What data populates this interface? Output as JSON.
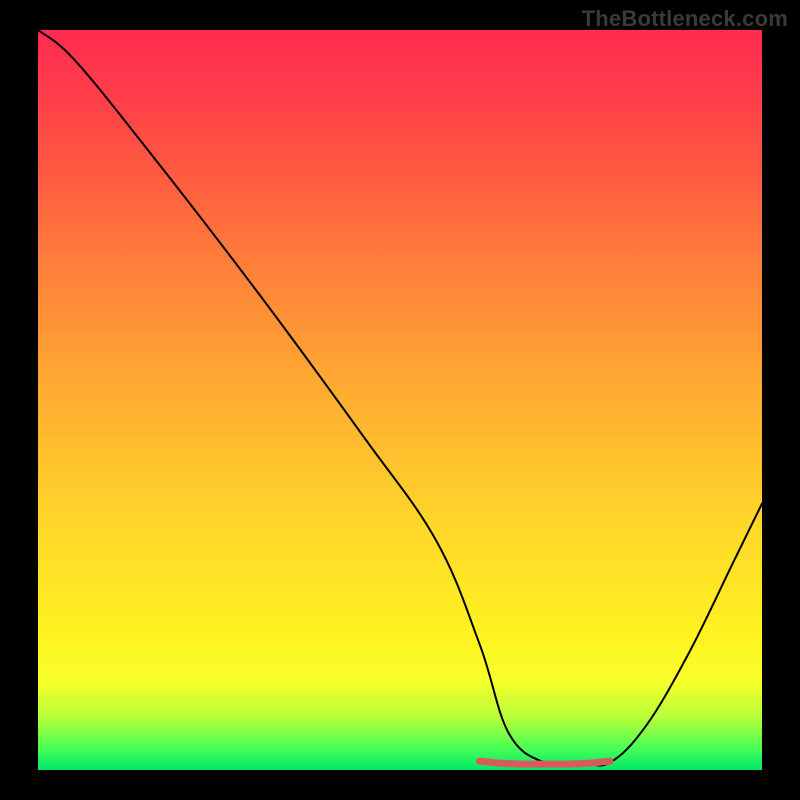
{
  "watermark": "TheBottleneck.com",
  "chart_data": {
    "type": "line",
    "title": "",
    "xlabel": "",
    "ylabel": "",
    "xlim": [
      0,
      100
    ],
    "ylim": [
      0,
      100
    ],
    "series": [
      {
        "name": "bottleneck-curve",
        "x": [
          0,
          5,
          15,
          30,
          45,
          55,
          61,
          65,
          70,
          75,
          79,
          84,
          90,
          96,
          100
        ],
        "values": [
          100,
          96,
          84,
          65,
          45,
          31,
          17,
          5,
          1,
          1,
          1,
          6,
          16,
          28,
          36
        ]
      },
      {
        "name": "bottom-marker",
        "x": [
          61,
          64,
          67,
          70,
          73,
          76,
          79
        ],
        "values": [
          1.2,
          0.9,
          0.8,
          0.8,
          0.8,
          0.9,
          1.2
        ]
      }
    ],
    "gradient_stops": [
      {
        "pos": 0,
        "color": "#ff2b4f"
      },
      {
        "pos": 18,
        "color": "#ff5642"
      },
      {
        "pos": 45,
        "color": "#ffa233"
      },
      {
        "pos": 82,
        "color": "#fff321"
      },
      {
        "pos": 100,
        "color": "#00e96a"
      }
    ]
  }
}
